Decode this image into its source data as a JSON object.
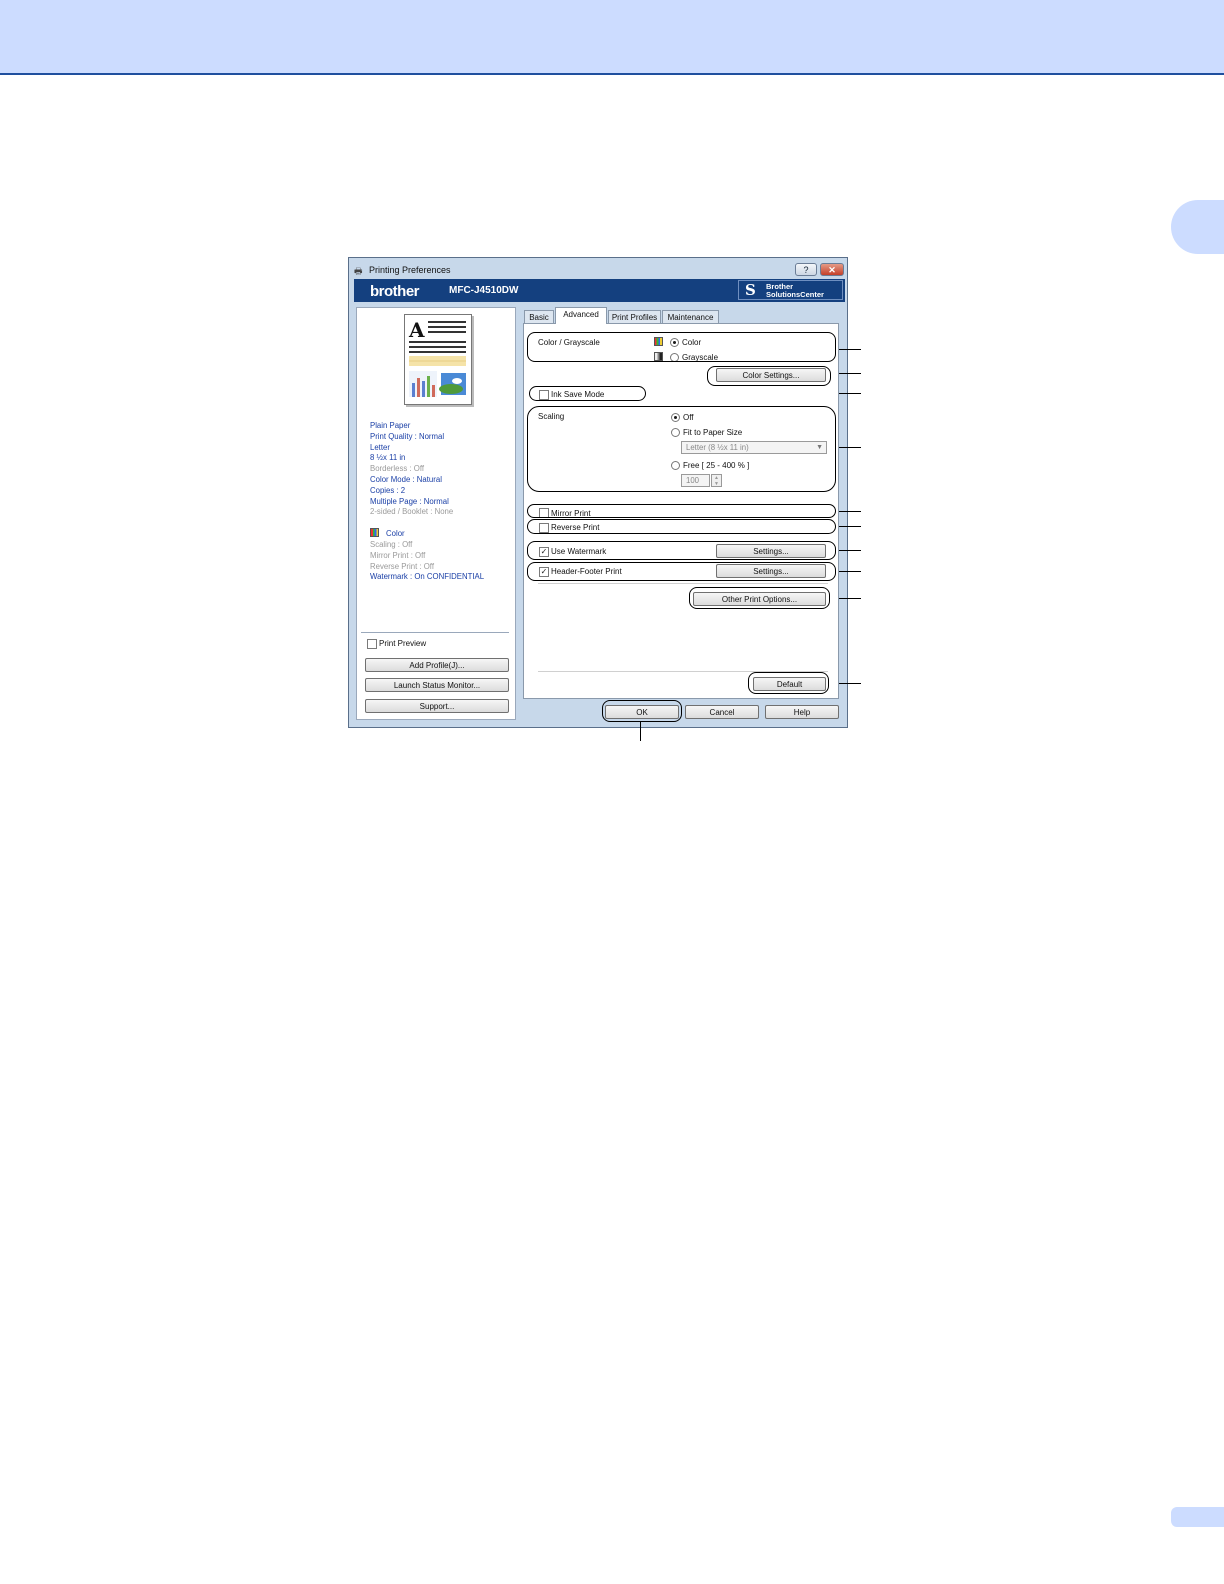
{
  "dialog": {
    "title": "Printing Preferences",
    "help_glyph": "?",
    "close_glyph": "✕",
    "brand": "brother",
    "model": "MFC-J4510DW",
    "solutions_line1": "Brother",
    "solutions_line2": "SolutionsCenter",
    "solutions_icon": "S"
  },
  "summary": {
    "lines_a": [
      {
        "text": "Plain Paper",
        "style": "blue"
      },
      {
        "text": "Print Quality : Normal",
        "style": "blue"
      },
      {
        "text": "Letter",
        "style": "blue"
      },
      {
        "text": "8 ½x 11 in",
        "style": "blue"
      },
      {
        "text": "Borderless : Off",
        "style": "gray"
      },
      {
        "text": "Color Mode : Natural",
        "style": "blue"
      },
      {
        "text": "Copies : 2",
        "style": "blue"
      },
      {
        "text": "Multiple Page : Normal",
        "style": "blue"
      },
      {
        "text": "2-sided / Booklet : None",
        "style": "gray"
      }
    ],
    "color_label": "Color",
    "lines_b": [
      {
        "text": "Scaling : Off",
        "style": "gray"
      },
      {
        "text": "Mirror Print : Off",
        "style": "gray"
      },
      {
        "text": "Reverse Print : Off",
        "style": "gray"
      },
      {
        "text": "Watermark : On  CONFIDENTIAL",
        "style": "blue"
      }
    ]
  },
  "left_controls": {
    "print_preview_label": "Print Preview",
    "add_profile_label": "Add Profile(J)...",
    "launch_status_label": "Launch Status Monitor...",
    "support_label": "Support..."
  },
  "tabs": [
    "Basic",
    "Advanced",
    "Print Profiles",
    "Maintenance"
  ],
  "active_tab": "Advanced",
  "advanced": {
    "color_grayscale_label": "Color / Grayscale",
    "color_option": "Color",
    "grayscale_option": "Grayscale",
    "color_settings_btn": "Color Settings...",
    "ink_save_label": "Ink Save Mode",
    "scaling_label": "Scaling",
    "scaling_off": "Off",
    "fit_to_paper": "Fit to Paper Size",
    "paper_size_value": "Letter (8 ½x 11 in)",
    "free_label": "Free [ 25 - 400 % ]",
    "free_value": "100",
    "mirror_print_label": "Mirror Print",
    "reverse_print_label": "Reverse Print",
    "use_watermark_label": "Use Watermark",
    "watermark_settings_btn": "Settings...",
    "header_footer_label": "Header-Footer Print",
    "header_footer_settings_btn": "Settings...",
    "other_print_options_btn": "Other Print Options...",
    "default_btn": "Default"
  },
  "footer_buttons": {
    "ok": "OK",
    "cancel": "Cancel",
    "help": "Help"
  },
  "state": {
    "color_selected": true,
    "scaling_off_selected": true,
    "ink_save_checked": false,
    "mirror_checked": false,
    "reverse_checked": false,
    "watermark_checked": true,
    "header_footer_checked": true,
    "print_preview_checked": false
  }
}
